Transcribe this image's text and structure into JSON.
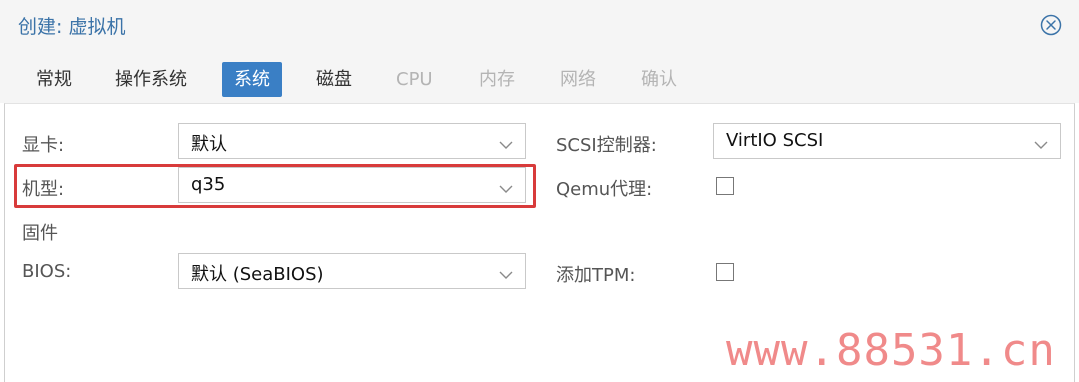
{
  "window": {
    "title": "创建: 虚拟机"
  },
  "tabs": [
    {
      "label": "常规",
      "state": "normal"
    },
    {
      "label": "操作系统",
      "state": "normal"
    },
    {
      "label": "系统",
      "state": "active"
    },
    {
      "label": "磁盘",
      "state": "normal"
    },
    {
      "label": "CPU",
      "state": "disabled"
    },
    {
      "label": "内存",
      "state": "disabled"
    },
    {
      "label": "网络",
      "state": "disabled"
    },
    {
      "label": "确认",
      "state": "disabled"
    }
  ],
  "form": {
    "graphics": {
      "label": "显卡:",
      "value": "默认"
    },
    "machine": {
      "label": "机型:",
      "value": "q35"
    },
    "firmware_section": "固件",
    "bios": {
      "label": "BIOS:",
      "value": "默认 (SeaBIOS)"
    },
    "scsi": {
      "label": "SCSI控制器:",
      "value": "VirtIO SCSI"
    },
    "qemu_agent": {
      "label": "Qemu代理:",
      "checked": false
    },
    "tpm": {
      "label": "添加TPM:",
      "checked": false
    }
  },
  "watermark": "www.88531.cn",
  "colors": {
    "accent": "#3a7fc5",
    "title": "#3b73a8",
    "highlight": "#d83b3b",
    "watermark": "#f08a8a"
  }
}
